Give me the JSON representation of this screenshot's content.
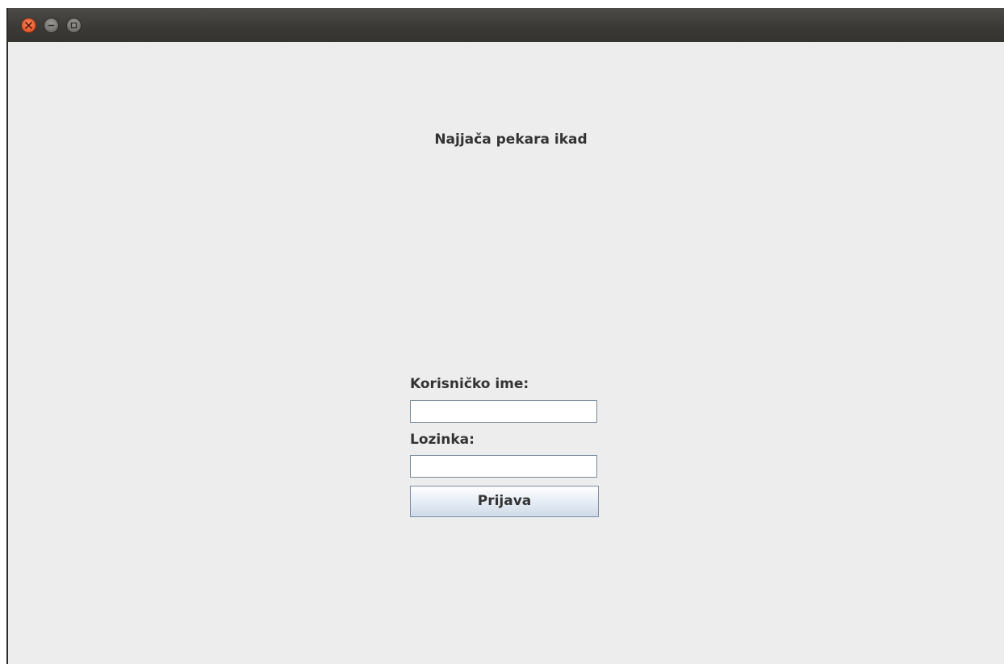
{
  "window": {
    "controls": {
      "close_icon": "close-icon",
      "minimize_icon": "minimize-icon",
      "maximize_icon": "maximize-icon"
    }
  },
  "main": {
    "title": "Najjača pekara ikad"
  },
  "login_form": {
    "username_label": "Korisničko ime:",
    "username_value": "",
    "password_label": "Lozinka:",
    "password_value": "",
    "submit_label": "Prijava"
  },
  "colors": {
    "titlebar": "#3a3935",
    "window_bg": "#ededed",
    "close_button": "#e0582b",
    "button_border": "#7a8ea6"
  }
}
